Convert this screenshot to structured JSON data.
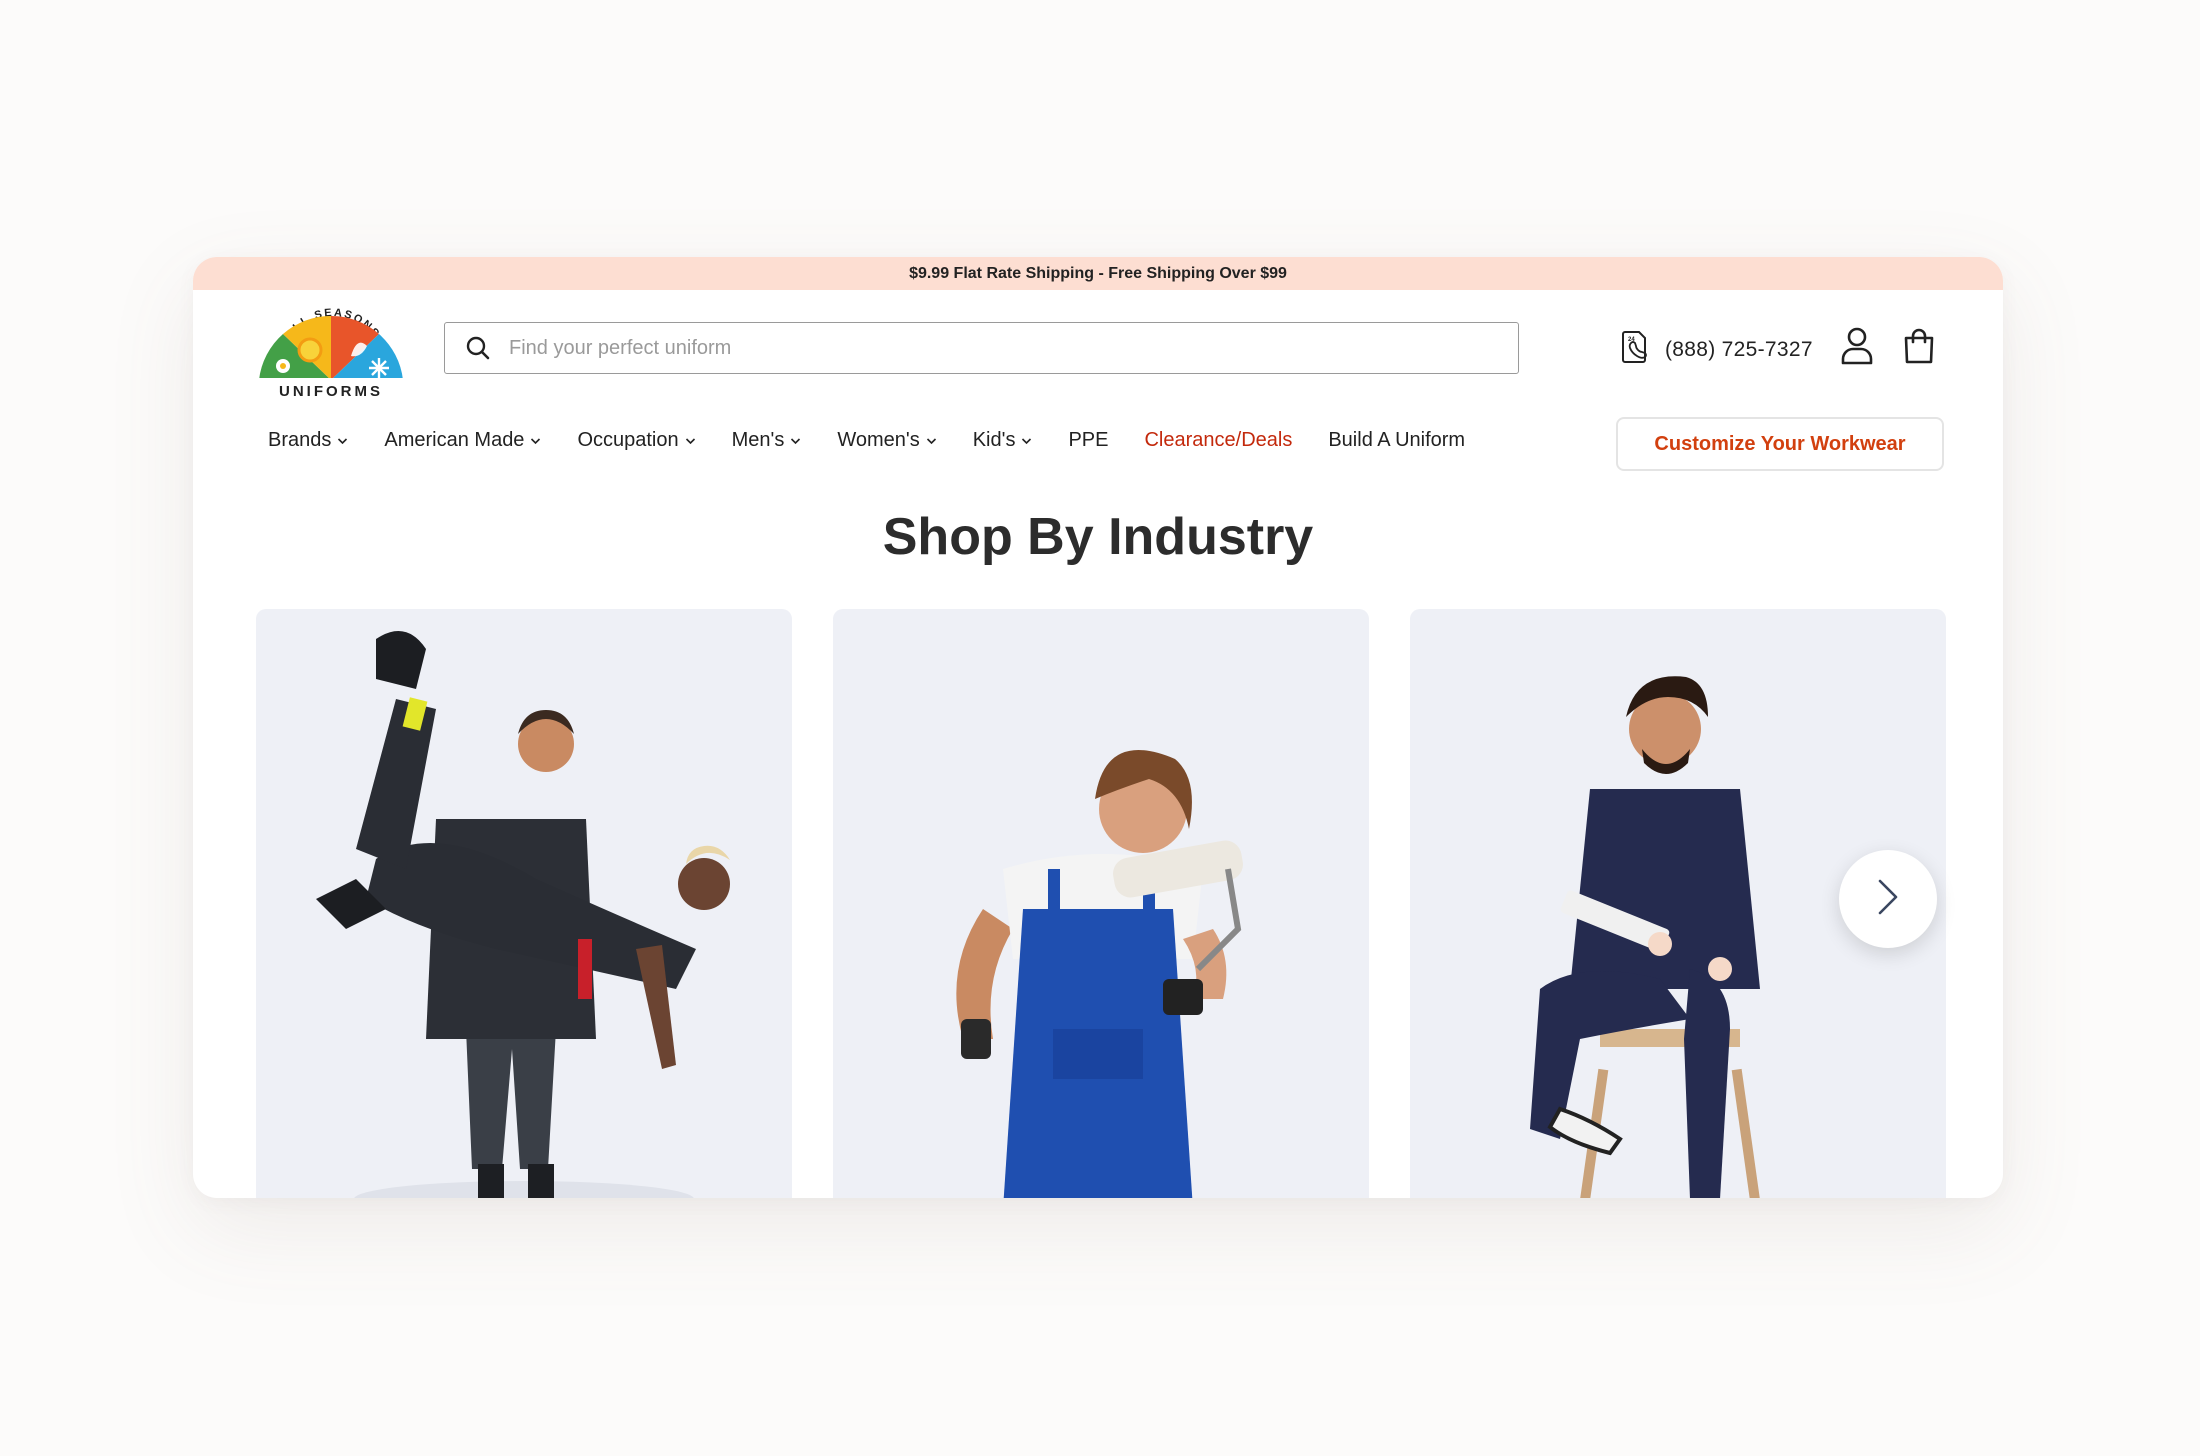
{
  "promo": {
    "text": "$9.99 Flat Rate Shipping - Free Shipping Over $99"
  },
  "logo": {
    "text_top": "ALL SEASONS",
    "text_bottom": "UNIFORMS"
  },
  "search": {
    "placeholder": "Find your perfect uniform",
    "value": ""
  },
  "header": {
    "phone": "(888) 725-7327"
  },
  "nav": {
    "items": [
      {
        "label": "Brands",
        "dropdown": true
      },
      {
        "label": "American Made",
        "dropdown": true
      },
      {
        "label": "Occupation",
        "dropdown": true
      },
      {
        "label": "Men's",
        "dropdown": true
      },
      {
        "label": "Women's",
        "dropdown": true
      },
      {
        "label": "Kid's",
        "dropdown": true
      },
      {
        "label": "PPE",
        "dropdown": false
      },
      {
        "label": "Clearance/Deals",
        "dropdown": false,
        "highlight": "#c3290c"
      },
      {
        "label": "Build A Uniform",
        "dropdown": false
      }
    ],
    "cta": "Customize Your Workwear"
  },
  "section": {
    "title": "Shop By Industry"
  },
  "icons": {
    "search": "search-icon",
    "phone": "phone-icon",
    "account": "user-icon",
    "cart": "shopping-bag-icon",
    "next": "chevron-right-icon"
  },
  "colors": {
    "promo_bg": "#fdded2",
    "accent": "#d2400f",
    "deals": "#c3290c",
    "tile_bg": "#eef0f6"
  }
}
